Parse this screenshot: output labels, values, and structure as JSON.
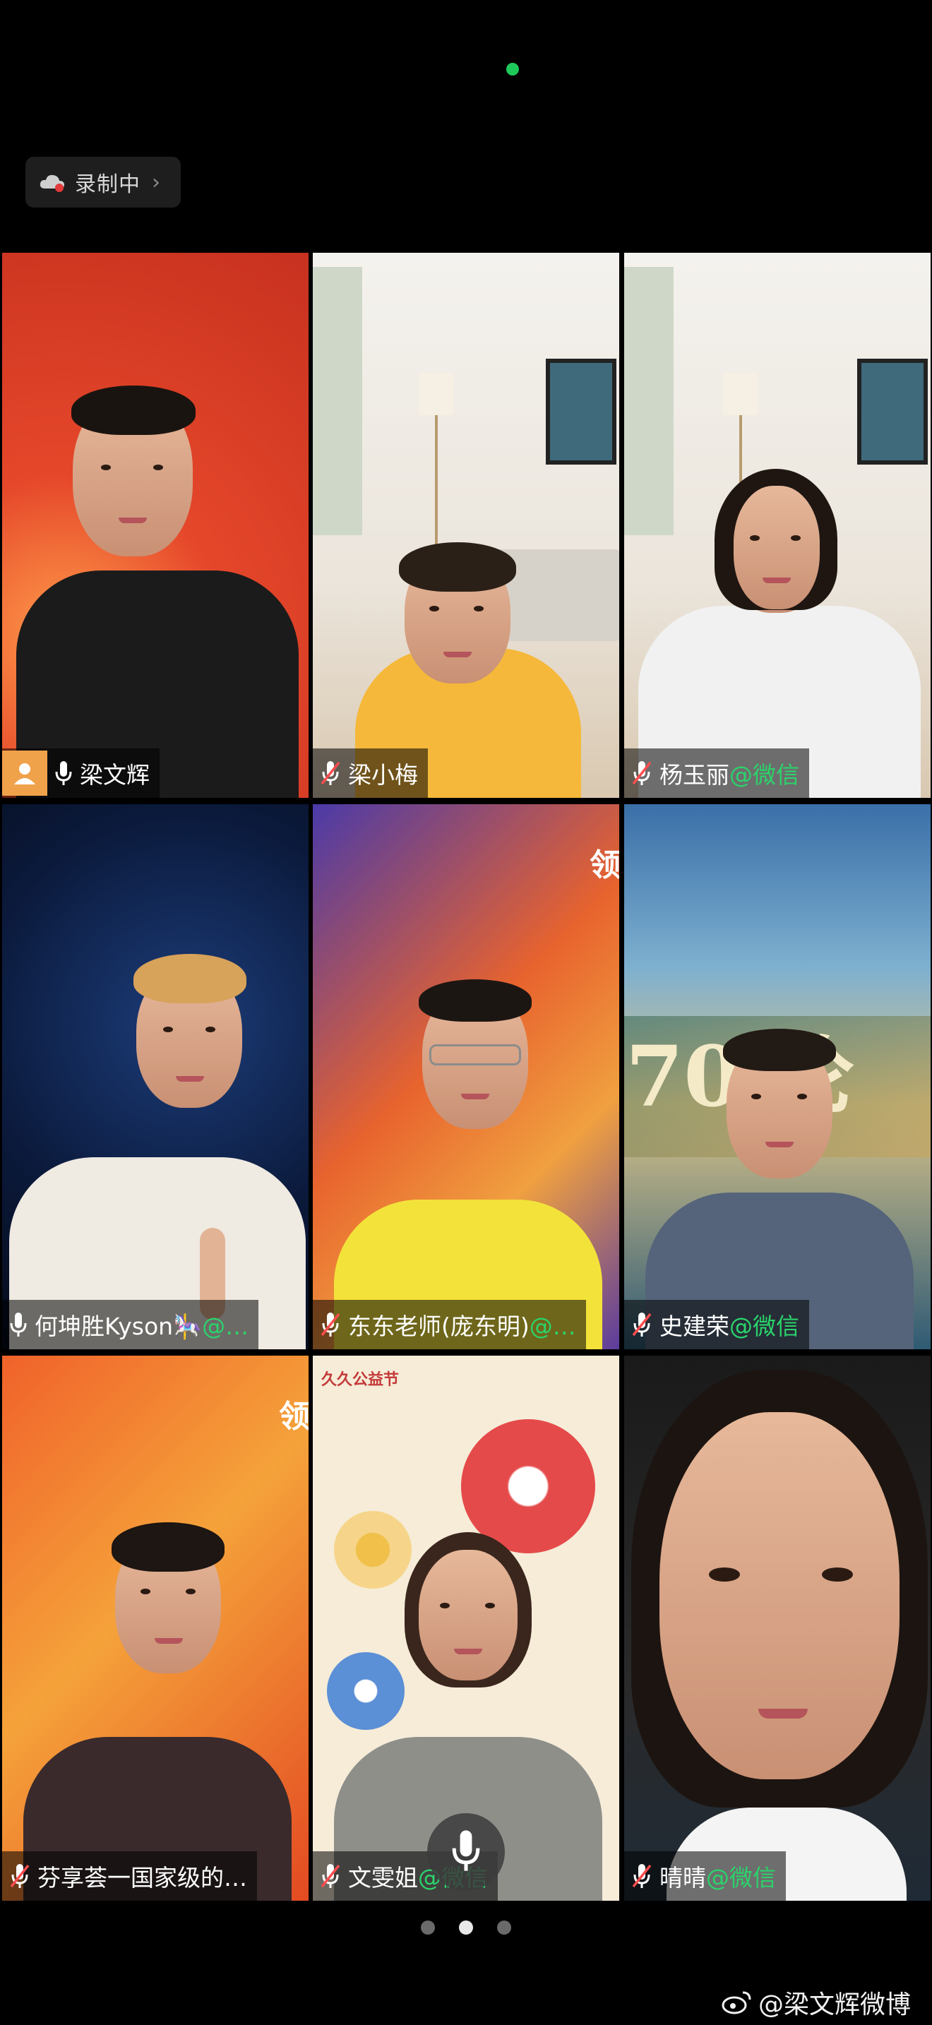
{
  "status": {
    "indicator_color": "#1ec95a"
  },
  "recording": {
    "label": "录制中",
    "chevron": "›"
  },
  "participants": [
    {
      "name": "梁文辉",
      "suffix": "",
      "mic": "on",
      "host": true,
      "active": true
    },
    {
      "name": "梁小梅",
      "suffix": "",
      "mic": "muted",
      "host": false,
      "active": false
    },
    {
      "name": "杨玉丽",
      "suffix": "@微信",
      "mic": "muted",
      "host": false,
      "active": false
    },
    {
      "name": "何坤胜Kyson🎠",
      "suffix": "@…",
      "mic": "on",
      "host": false,
      "active": false
    },
    {
      "name": "东东老师(庞东明)",
      "suffix": "@…",
      "mic": "muted",
      "host": false,
      "active": false
    },
    {
      "name": "史建荣",
      "suffix": "@微信",
      "mic": "muted",
      "host": false,
      "active": false
    },
    {
      "name": "芬享荟一国家级的…",
      "suffix": "",
      "mic": "muted",
      "host": false,
      "active": false
    },
    {
      "name": "文雯姐",
      "suffix": "@微信",
      "mic": "muted",
      "host": false,
      "active": false
    },
    {
      "name": "晴晴",
      "suffix": "@微信",
      "mic": "muted",
      "host": false,
      "active": false
    }
  ],
  "backgrounds": {
    "tile5_text": "70 伦",
    "tile4_text": "领",
    "tile6_text": "领",
    "tile7_text": "久久公益节"
  },
  "pagination": {
    "pages": 3,
    "current": 2
  },
  "watermark": {
    "text": "@梁文辉微博"
  },
  "colors": {
    "accent": "#16c44e",
    "wechat_suffix": "#2bd36b",
    "host_badge": "#f0a24a"
  }
}
